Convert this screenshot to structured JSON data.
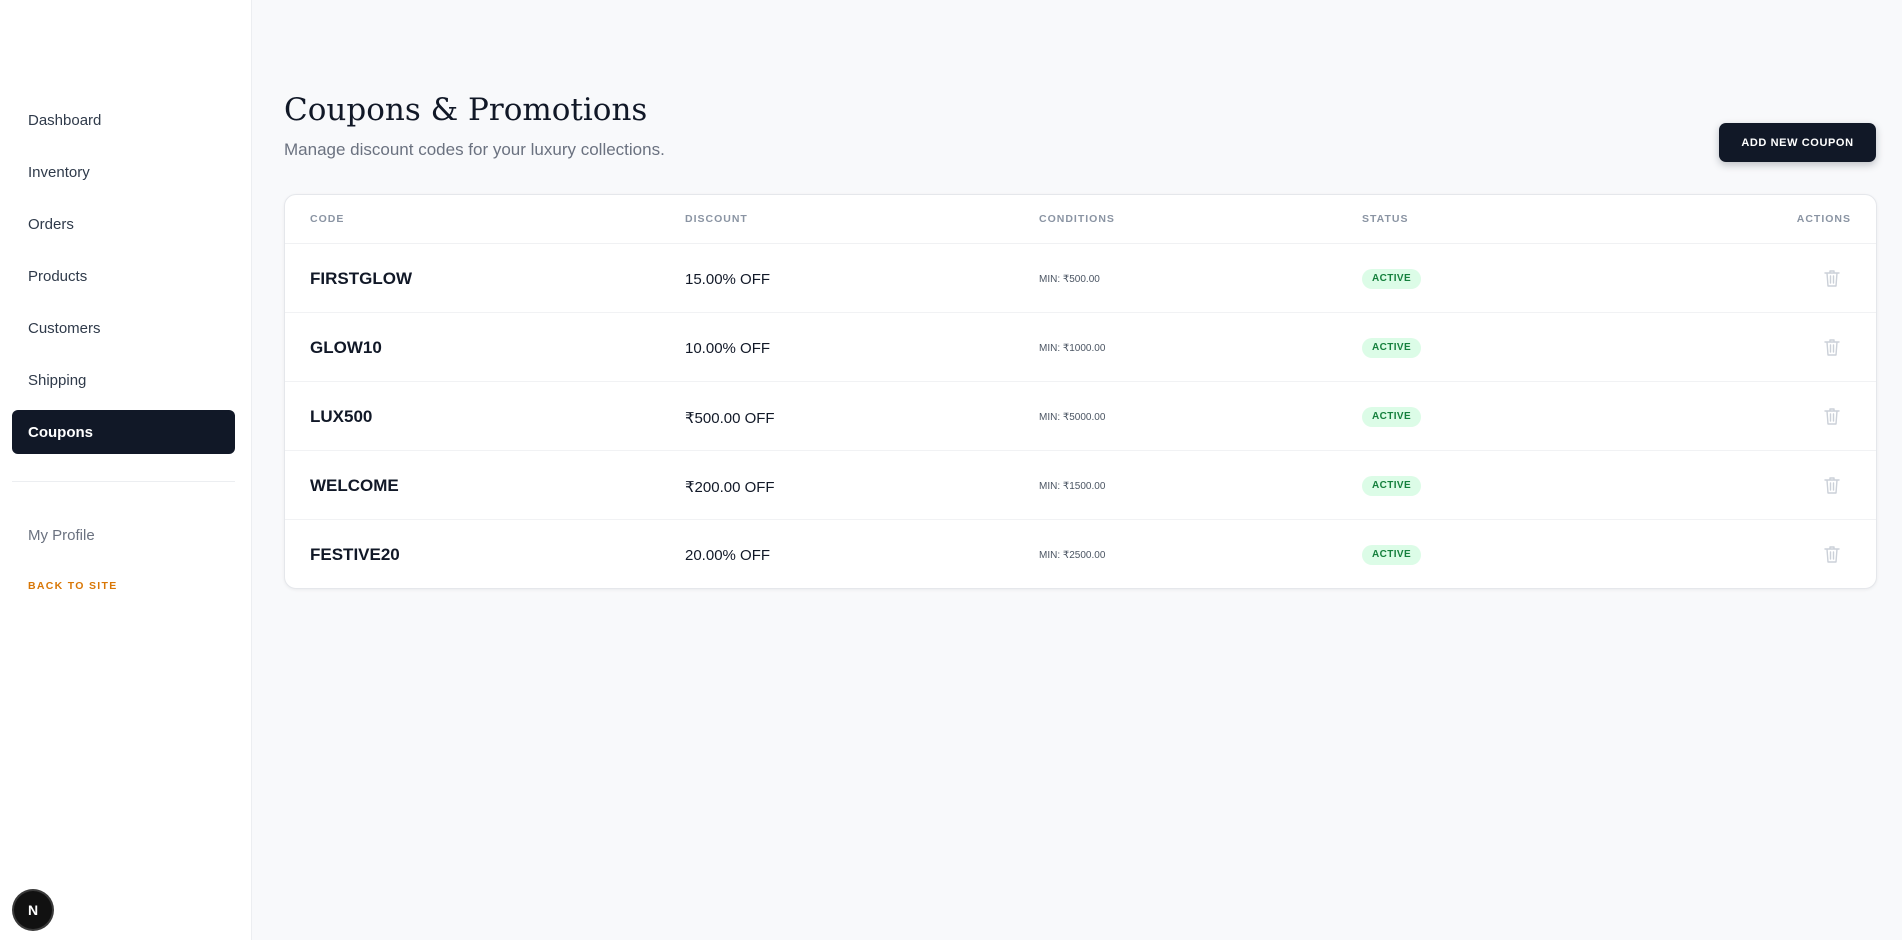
{
  "sidebar": {
    "nav": [
      {
        "label": "Dashboard"
      },
      {
        "label": "Inventory"
      },
      {
        "label": "Orders"
      },
      {
        "label": "Products"
      },
      {
        "label": "Customers"
      },
      {
        "label": "Shipping"
      },
      {
        "label": "Coupons",
        "active": true
      }
    ],
    "profile_label": "My Profile",
    "back_label": "BACK TO SITE",
    "badge_letter": "N"
  },
  "header": {
    "title": "Coupons & Promotions",
    "subtitle": "Manage discount codes for your luxury collections.",
    "add_button_label": "ADD NEW COUPON"
  },
  "table": {
    "columns": [
      "CODE",
      "DISCOUNT",
      "CONDITIONS",
      "STATUS",
      "ACTIONS"
    ],
    "rows": [
      {
        "code": "FIRSTGLOW",
        "discount": "15.00% OFF",
        "conditions": "MIN: ₹500.00",
        "status": "ACTIVE"
      },
      {
        "code": "GLOW10",
        "discount": "10.00% OFF",
        "conditions": "MIN: ₹1000.00",
        "status": "ACTIVE"
      },
      {
        "code": "LUX500",
        "discount": "₹500.00 OFF",
        "conditions": "MIN: ₹5000.00",
        "status": "ACTIVE"
      },
      {
        "code": "WELCOME",
        "discount": "₹200.00 OFF",
        "conditions": "MIN: ₹1500.00",
        "status": "ACTIVE"
      },
      {
        "code": "FESTIVE20",
        "discount": "20.00% OFF",
        "conditions": "MIN: ₹2500.00",
        "status": "ACTIVE"
      }
    ],
    "row_action_icon": "trash-icon"
  },
  "colors": {
    "primary": "#111827",
    "accent": "#d97706",
    "status_active_bg": "#dcfce7",
    "status_active_text": "#15803d",
    "page_bg": "#f8f9fb"
  }
}
